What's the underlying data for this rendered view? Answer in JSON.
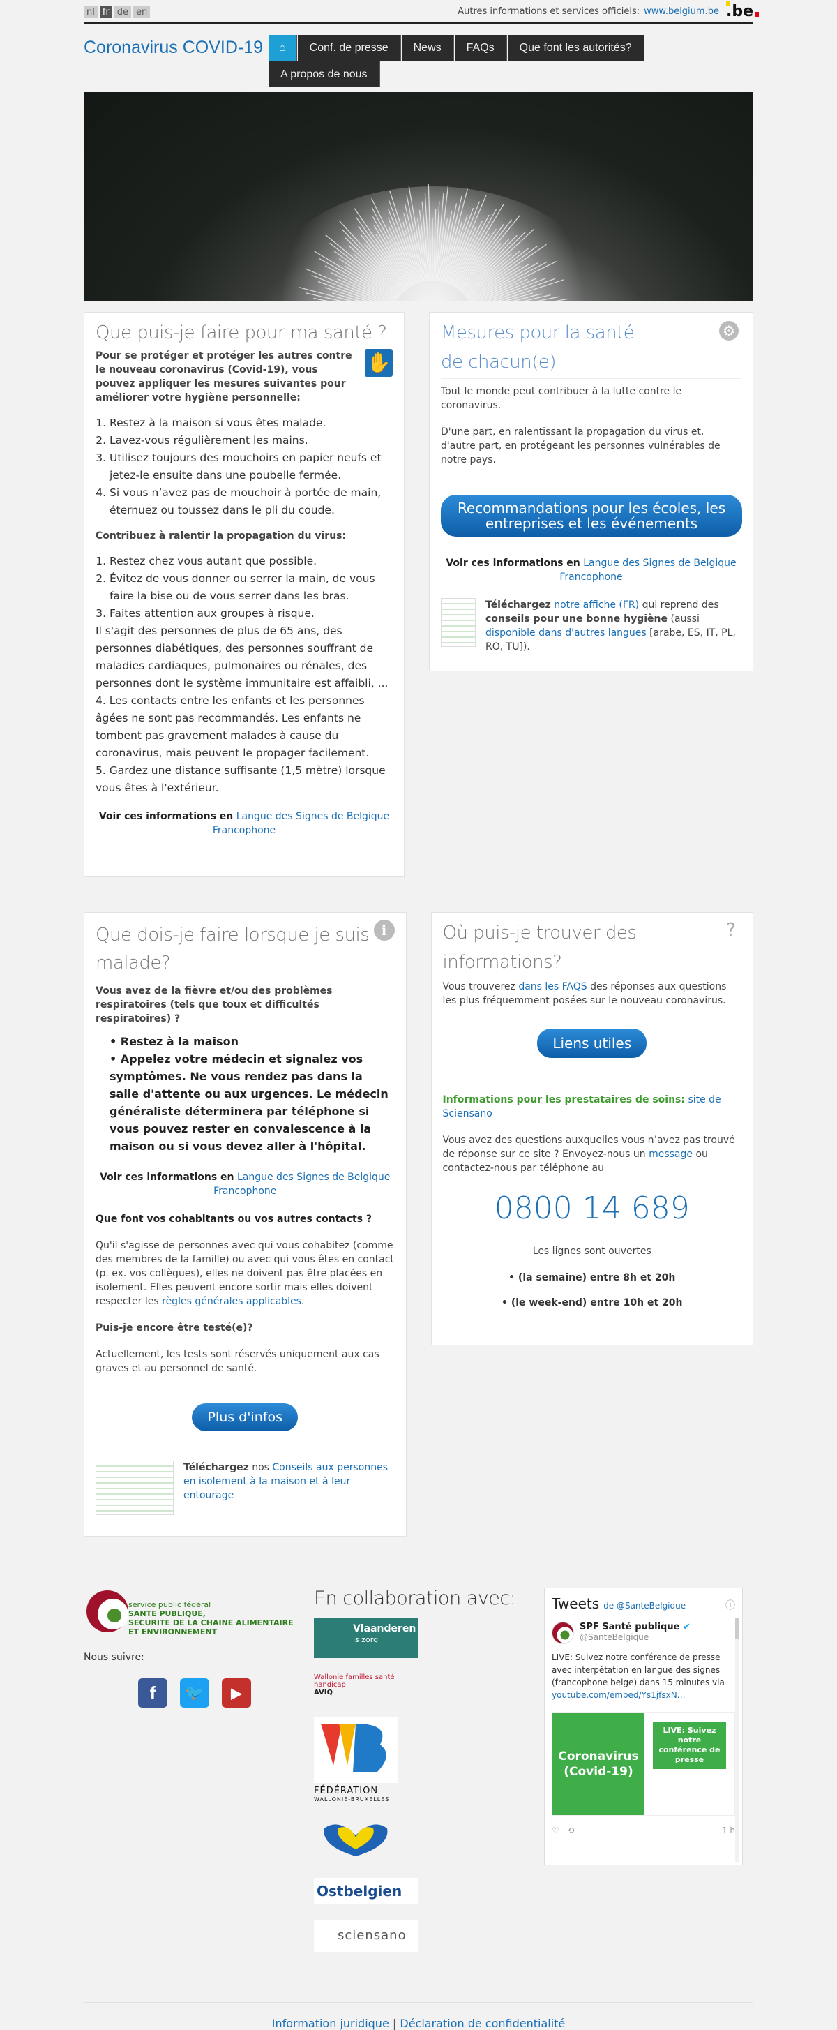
{
  "topbar": {
    "langs": [
      "nl",
      "fr",
      "de",
      "en"
    ],
    "official_text": "Autres informations et services officiels:",
    "official_link": "www.belgium.be",
    "be_logo": ".be"
  },
  "header": {
    "title": "Coronavirus COVID-19",
    "nav": [
      "⌂",
      "Conf. de presse",
      "News",
      "FAQs",
      "Que font les autorités?",
      "A propos de nous"
    ]
  },
  "card_sante": {
    "title": "Que puis-je faire pour ma santé ?",
    "intro": "Pour se protéger et protéger les autres contre le nouveau coronavirus (Covid-19), vous pouvez appliquer les mesures suivantes pour améliorer votre hygiène personnelle:",
    "hygiene": [
      "Restez à la maison si vous êtes malade.",
      "Lavez-vous régulièrement les mains.",
      "Utilisez toujours des mouchoirs en papier neufs et jetez-le ensuite dans une poubelle fermée.",
      "Si vous n’avez pas de mouchoir à portée de main, éternuez ou toussez dans le pli du coude."
    ],
    "subtitle": "Contribuez à ralentir la propagation du virus:",
    "measures_1": [
      "Restez chez vous autant que possible.",
      "Évitez de vous donner ou serrer la main, de vous faire la bise ou de vous serrer dans les bras.",
      "Faites attention aux groupes à risque."
    ],
    "risk_text": "Il s'agit des personnes de plus de 65 ans, des personnes diabétiques, des personnes souffrant de maladies cardiaques, pulmonaires ou rénales, des personnes dont le système immunitaire est affaibli, ...",
    "measures_2": [
      "Les contacts entre les enfants et les personnes âgées ne sont pas recommandés. Les enfants ne tombent pas gravement malades à cause du coronavirus, mais peuvent le propager facilement.",
      "Gardez une distance suffisante (1,5 mètre) lorsque vous êtes à l'extérieur."
    ],
    "measures_2_num": [
      "4.",
      "5."
    ],
    "lsb_prefix": "Voir ces informations en",
    "lsb_link": "Langue des Signes de Belgique Francophone"
  },
  "card_mesures": {
    "title": "Mesures pour la santé de chacun(e)",
    "p1": "Tout le monde peut contribuer à la lutte contre le coronavirus.",
    "p2": "D'une part, en ralentissant la propagation du virus et, d'autre part, en protégeant les personnes vulnérables de notre pays.",
    "button": "Recommandations pour les écoles, les entreprises et les événements",
    "lsb_prefix": "Voir ces informations en",
    "lsb_link": "Langue des Signes de Belgique Francophone",
    "dl_bold": "Téléchargez",
    "dl_link": "notre affiche (FR)",
    "dl_mid": "qui reprend des",
    "dl_bold2": "conseils pour une bonne hygiène",
    "dl_paren": "(aussi",
    "dl_link2": "disponible dans d'autres langues",
    "dl_end": "[arabe, ES, IT, PL, RO, TU])."
  },
  "card_malade": {
    "title": "Que dois-je faire lorsque je suis malade?",
    "question": "Vous avez de la fièvre et/ou des problèmes respiratoires (tels que toux et difficultés respiratoires) ?",
    "bullets": [
      "Restez à la maison",
      "Appelez votre médecin et signalez vos symptômes. Ne vous rendez pas dans la salle d'attente ou aux urgences. Le médecin généraliste déterminera par téléphone si vous pouvez rester en convalescence à la maison ou si vous devez aller à l'hôpital."
    ],
    "lsb_prefix": "Voir ces informations en",
    "lsb_link": "Langue des Signes de Belgique Francophone",
    "contacts_title": "Que font vos cohabitants ou vos autres contacts ?",
    "contacts_text": "Qu'il s'agisse de personnes avec qui vous cohabitez (comme des membres de la famille) ou avec qui vous êtes en contact (p. ex. vos collègues), elles ne doivent pas être placées en isolement. Elles peuvent encore sortir mais elles doivent respecter les",
    "contacts_link": "règles générales applicables",
    "test_title": "Puis-je encore être testé(e)?",
    "test_text": "Actuellement, les tests sont réservés uniquement aux cas graves et au personnel de santé.",
    "button": "Plus d'infos",
    "dl_bold": "Téléchargez",
    "dl_mid": "nos",
    "dl_link": "Conseils aux personnes en isolement à la maison et à leur entourage"
  },
  "card_info": {
    "title": "Où puis-je trouver des informations?",
    "p1_a": "Vous trouverez",
    "p1_link": "dans les FAQS",
    "p1_b": "des réponses aux questions les plus fréquemment posées sur le nouveau coronavirus.",
    "button": "Liens utiles",
    "prest_label": "Informations pour les prestataires de soins:",
    "prest_link": "site de Sciensano",
    "q_text": "Vous avez des questions auxquelles vous n’avez pas trouvé de réponse sur ce site ? Envoyez-nous un",
    "q_link": "message",
    "q_end": "ou contactez-nous par téléphone au",
    "phone": "0800 14 689",
    "open": "Les lignes sont ouvertes",
    "hours": [
      "• (la semaine) entre 8h et 20h",
      "• (le week-end) entre 10h et 20h"
    ]
  },
  "footer": {
    "spf_lines": [
      "service public fédéral",
      "SANTE PUBLIQUE,",
      "SECURITE DE LA CHAINE ALIMENTAIRE",
      "ET ENVIRONNEMENT"
    ],
    "follow": "Nous suivre:",
    "collab_title": "En collaboration avec:",
    "logos": [
      "Vlaanderen",
      "is zorg",
      "Wallonie familles santé handicap",
      "AVIQ",
      "FÉDÉRATION",
      "WALLONIE-BRUXELLES",
      "Ostbelgien",
      "sciensano"
    ],
    "tweets_title": "Tweets",
    "tweets_by": "de @SanteBelgique",
    "tweet_name": "SPF Santé publique",
    "tweet_handle": "@SanteBelgique",
    "tweet_text": "LIVE: Suivez notre conférence de presse avec interpétation en langue des signes (francophone belge) dans 15 minutes via",
    "tweet_link": "youtube.com/embed/Ys1jfsxN…",
    "tweet_img_left": "Coronavirus (Covid-19)",
    "tweet_img_right": "LIVE: Suivez notre conférence de presse",
    "tweet_time": "1 h",
    "links": [
      "Information juridique",
      "Déclaration de confidentialité"
    ],
    "sep": "|"
  },
  "colors": {
    "accent": "#1a6fb5",
    "nav": "#2b2b2b",
    "home": "#1e9fd6",
    "green": "#3fae49"
  }
}
